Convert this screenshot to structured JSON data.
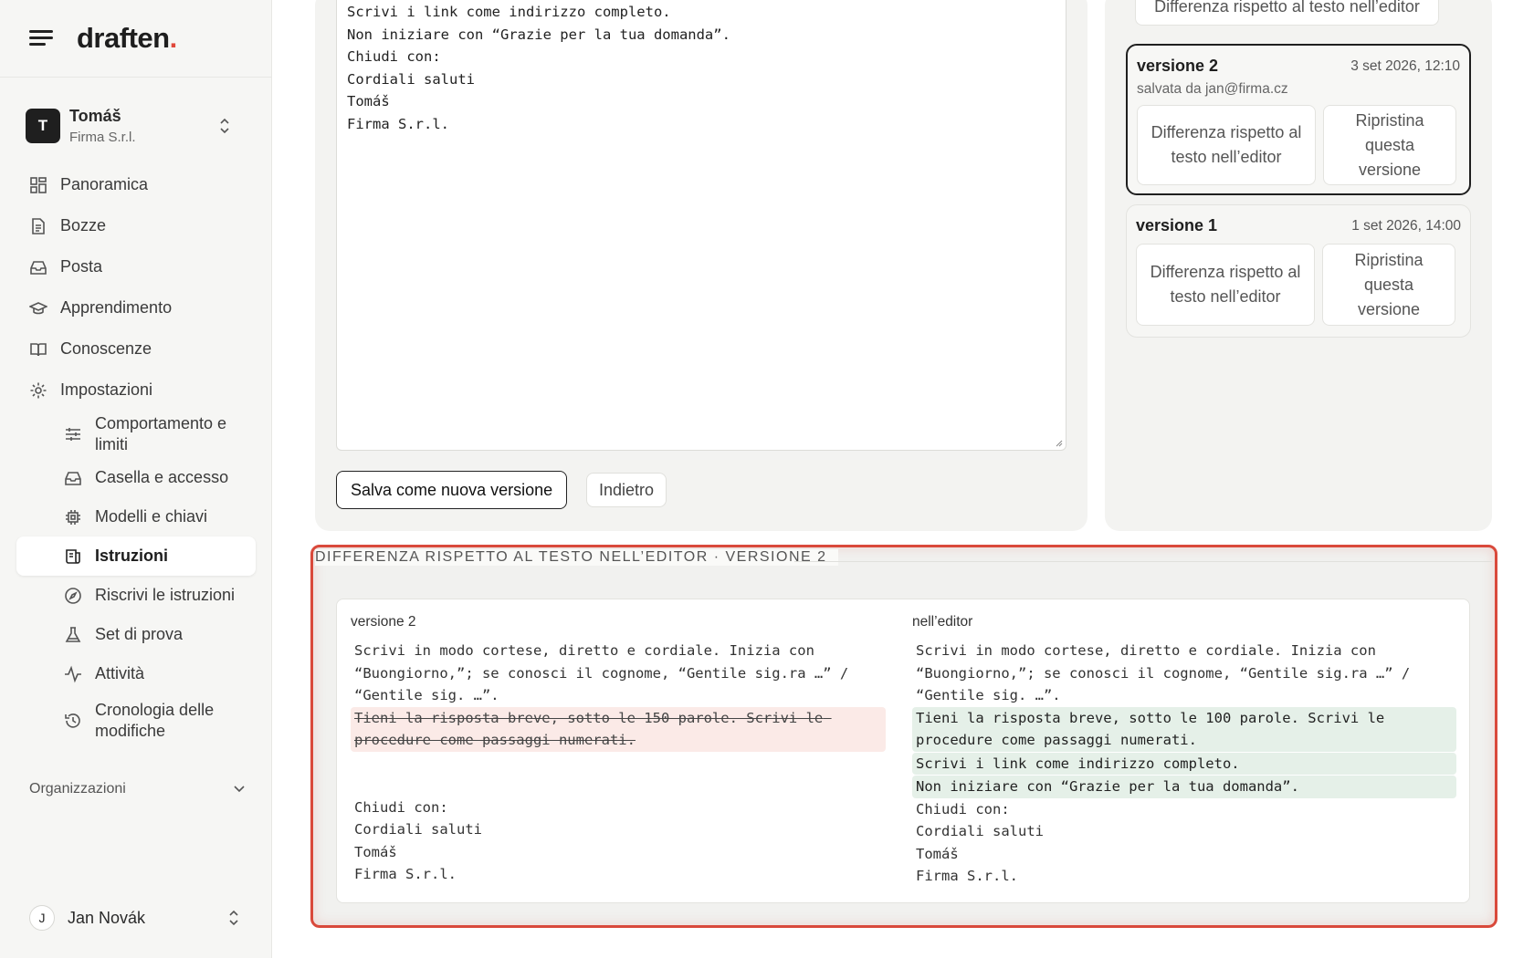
{
  "app": {
    "logo_text": "draften",
    "logo_dot": ".",
    "accent": "#e0483a"
  },
  "account": {
    "initial": "T",
    "name": "Tomáš",
    "company": "Firma S.r.l."
  },
  "nav": {
    "overview": "Panoramica",
    "drafts": "Bozze",
    "mail": "Posta",
    "learning": "Apprendimento",
    "knowledge": "Conoscenze",
    "settings": "Impostazioni",
    "sub": {
      "behaviour": "Comportamento e limiti",
      "mailbox": "Casella e accesso",
      "models": "Modelli e chiavi",
      "instructions": "Istruzioni",
      "rewrite": "Riscrivi le istruzioni",
      "testset": "Set di prova",
      "activity": "Attività",
      "history": "Cronologia delle modifiche"
    }
  },
  "organizations": {
    "label": "Organizzazioni"
  },
  "user": {
    "initial": "J",
    "name": "Jan Novák"
  },
  "editor": {
    "lines": [
      "Scrivi i link come indirizzo completo.",
      "Non iniziare con “Grazie per la tua domanda”.",
      "Chiudi con:",
      "Cordiali saluti",
      "Tomáš",
      "Firma S.r.l."
    ],
    "save_label": "Salva come nuova versione",
    "back_label": "Indietro"
  },
  "versions": {
    "top_button": "Differenza rispetto al testo nell’editor",
    "items": [
      {
        "title": "versione 2",
        "date": "3 set 2026, 12:10",
        "saved_by": "salvata da jan@firma.cz",
        "diff_btn": "Differenza rispetto al testo nell’editor",
        "restore_btn": "Ripristina questa versione"
      },
      {
        "title": "versione 1",
        "date": "1 set 2026, 14:00",
        "diff_btn": "Differenza rispetto al testo nell’editor",
        "restore_btn": "Ripristina questa versione"
      }
    ]
  },
  "diff": {
    "title": "DIFFERENZA RISPETTO AL TESTO NELL’EDITOR · VERSIONE 2",
    "left_head": "versione 2",
    "right_head": "nell’editor",
    "common_intro": "Scrivi in modo cortese, diretto e cordiale. Inizia con “Buongiorno,”; se conosci il cognome, “Gentile sig.ra …” / “Gentile sig. …”.",
    "removed": "Tieni la risposta breve, sotto le 150 parole. Scrivi le procedure come passaggi numerati.",
    "added": [
      "Tieni la risposta breve, sotto le 100 parole. Scrivi le procedure come passaggi numerati.",
      "Scrivi i link come indirizzo completo.",
      "Non iniziare con “Grazie per la tua domanda”."
    ],
    "common_end": [
      "Chiudi con:",
      "Cordiali saluti",
      "Tomáš",
      "Firma S.r.l."
    ]
  }
}
